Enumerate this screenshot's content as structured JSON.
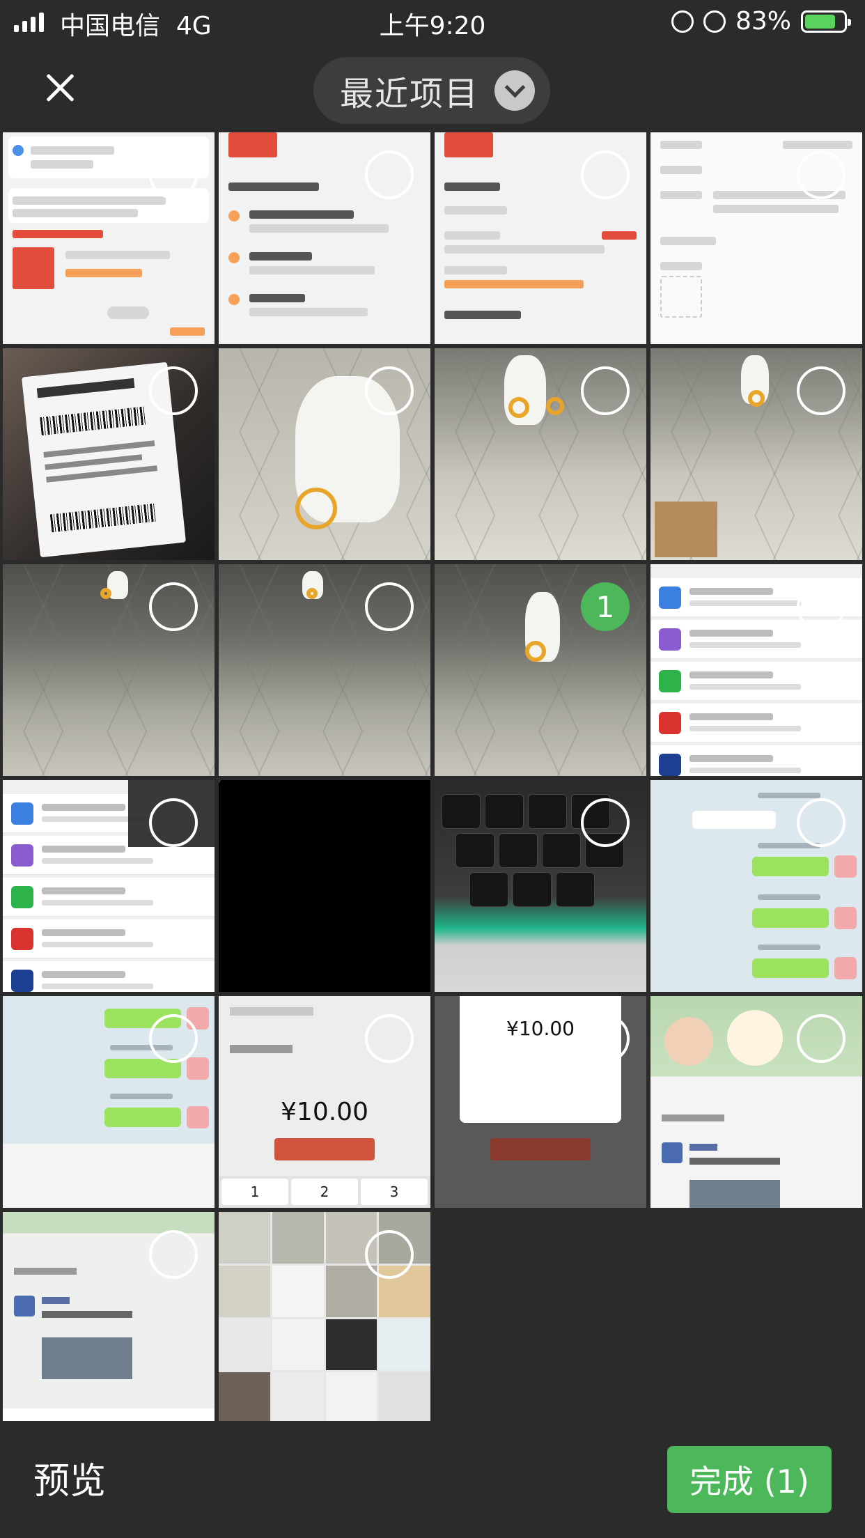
{
  "status_bar": {
    "carrier": "中国电信",
    "network": "4G",
    "time": "上午9:20",
    "battery_percent": "83%"
  },
  "top_bar": {
    "album_label": "最近项目"
  },
  "grid": {
    "selected_index": 10,
    "selected_number": "1",
    "selected_color": "#4cb85a"
  },
  "thumbnails": {
    "redpacket_amount_1": "¥10.00",
    "redpacket_amount_2": "¥10.00",
    "numpad_1": "1",
    "numpad_2": "2",
    "numpad_3": "3"
  },
  "bottom_bar": {
    "preview_label": "预览",
    "done_label": "完成 (1)"
  }
}
